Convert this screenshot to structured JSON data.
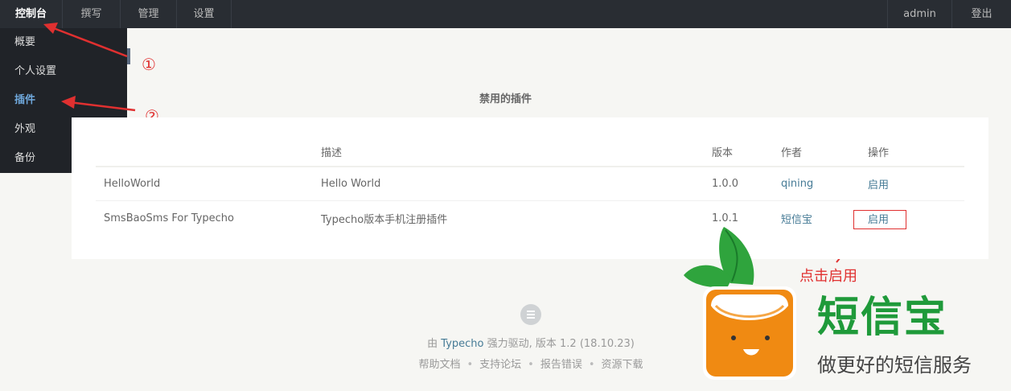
{
  "topbar": {
    "nav": [
      "控制台",
      "撰写",
      "管理",
      "设置"
    ],
    "user": "admin",
    "logout": "登出"
  },
  "dropdown": {
    "items": [
      "概要",
      "个人设置",
      "插件",
      "外观",
      "备份"
    ]
  },
  "section_title": "禁用的插件",
  "table": {
    "headers": [
      "",
      "描述",
      "版本",
      "作者",
      "操作"
    ],
    "rows": [
      {
        "name": "HelloWorld",
        "desc": "Hello World",
        "version": "1.0.0",
        "author": "qining",
        "action": "启用"
      },
      {
        "name": "SmsBaoSms For Typecho",
        "desc": "Typecho版本手机注册插件",
        "version": "1.0.1",
        "author": "短信宝",
        "action": "启用"
      }
    ]
  },
  "annotations": {
    "num1": "①",
    "num2": "②",
    "click_hint": "点击启用"
  },
  "footer": {
    "prefix": "由",
    "typecho": "Typecho",
    "suffix": "强力驱动, 版本 1.2 (18.10.23)",
    "links": [
      "帮助文档",
      "支持论坛",
      "报告错误",
      "资源下载"
    ]
  },
  "brand": {
    "name": "短信宝",
    "slogan": "做更好的短信服务",
    "colors": {
      "green": "#1f9a3a",
      "orange": "#f08a12"
    }
  }
}
